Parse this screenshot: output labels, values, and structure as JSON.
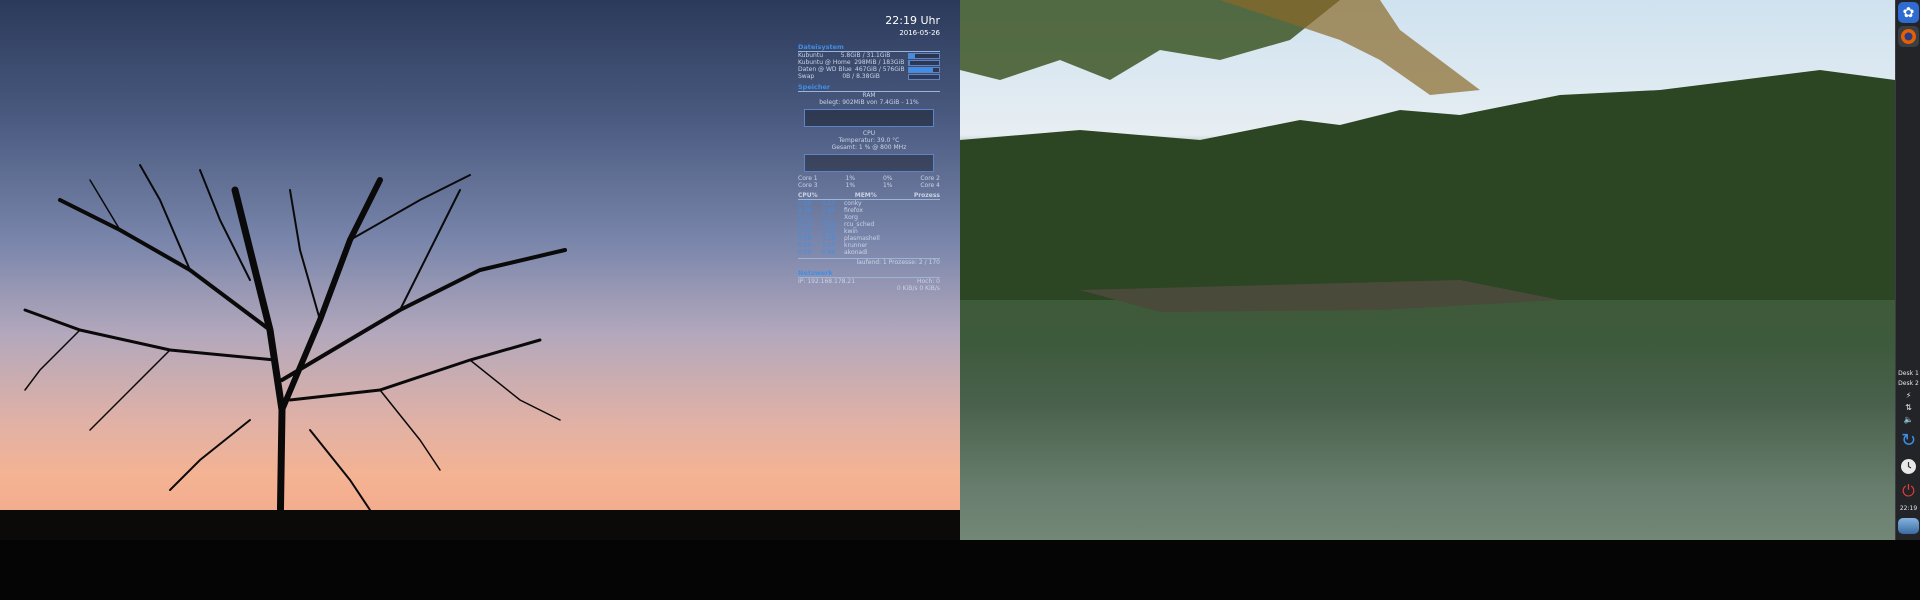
{
  "conky": {
    "time": "22:19 Uhr",
    "date": "2016-05-26",
    "system": {
      "title": "Dateisystem",
      "rows": [
        {
          "name": "Kubuntu",
          "value": "5.8GiB / 31.1GiB",
          "fill_pct": 19
        },
        {
          "name": "Kubuntu @ Home",
          "value": "298MiB / 183GiB",
          "fill_pct": 1
        },
        {
          "name": "Daten @ WD Blue",
          "value": "467GiB / 576GiB",
          "fill_pct": 81
        },
        {
          "name": "Swap",
          "value": "0B / 8.38GiB",
          "fill_pct": 0
        }
      ]
    },
    "memory": {
      "title": "Speicher",
      "ram_label": "RAM",
      "ram_line": "belegt: 902MiB von 7.4GiB - 11%",
      "cpu_label": "CPU",
      "temp_line": "Temperatur: 39.0 °C",
      "gesamt_line": "Gesamt: 1 % @ 800 MHz",
      "cores": [
        {
          "left": "Core 1",
          "l": "1%",
          "r": "0%",
          "right": "Core 2"
        },
        {
          "left": "Core 3",
          "l": "1%",
          "r": "1%",
          "right": "Core 4"
        }
      ]
    },
    "processes": {
      "headers": [
        "CPU%",
        "MEM%",
        "Prozess"
      ],
      "rows": [
        {
          "cpu": "0.99",
          "mem": "0.23",
          "name": "conky"
        },
        {
          "cpu": "0.38",
          "mem": "1.41",
          "name": "firefox"
        },
        {
          "cpu": "0.25",
          "mem": "1.7",
          "name": "Xorg"
        },
        {
          "cpu": "0.12",
          "mem": "0.04",
          "name": "rcu_sched"
        },
        {
          "cpu": "0.00",
          "mem": "1.84",
          "name": "kwin"
        },
        {
          "cpu": "0.00",
          "mem": "1.38",
          "name": "plasmashell"
        },
        {
          "cpu": "0.00",
          "mem": "1.17",
          "name": "krunner"
        },
        {
          "cpu": "0.00",
          "mem": "0.86",
          "name": "akonadi"
        }
      ],
      "footer": "laufend: 1  Prozesse: 2 / 170"
    },
    "network": {
      "title": "Netzwerk",
      "ip": "IP: 192.168.178.21",
      "left_stats": "Hoch: 0",
      "right_stats": "0 KiB/s  0 KiB/s"
    }
  },
  "dock": {
    "desk1": "Desk 1",
    "desk2": "Desk 2",
    "clock": "22:19"
  },
  "colors": {
    "accent": "#3f8fe8",
    "dock_bg": "#222428"
  }
}
